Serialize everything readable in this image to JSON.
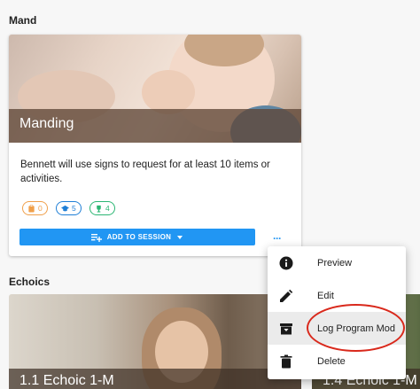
{
  "sections": {
    "first_title": "Mand",
    "second_title": "Echoics"
  },
  "card": {
    "title": "Manding",
    "description": "Bennett will use signs to request for at least 10 items or activities.",
    "badges": [
      {
        "icon": "clipboard-icon",
        "value": "0",
        "color": "#f0a04b"
      },
      {
        "icon": "graduation-cap-icon",
        "value": "5",
        "color": "#1f7fd6"
      },
      {
        "icon": "trophy-icon",
        "value": "4",
        "color": "#2bb673"
      }
    ],
    "add_button_label": "ADD TO SESSION",
    "more_label": "···"
  },
  "bottom_cards": [
    {
      "title": "1.1 Echoic 1-M"
    },
    {
      "title": "1.4 Echoic 1-M"
    }
  ],
  "menu": {
    "items": [
      {
        "label": "Preview",
        "icon": "info-icon"
      },
      {
        "label": "Edit",
        "icon": "pencil-icon"
      },
      {
        "label": "Log Program Mod",
        "icon": "archive-box-icon"
      },
      {
        "label": "Delete",
        "icon": "trash-icon"
      }
    ]
  },
  "colors": {
    "accent": "#2196f3",
    "highlight_circle": "#d9291c"
  }
}
